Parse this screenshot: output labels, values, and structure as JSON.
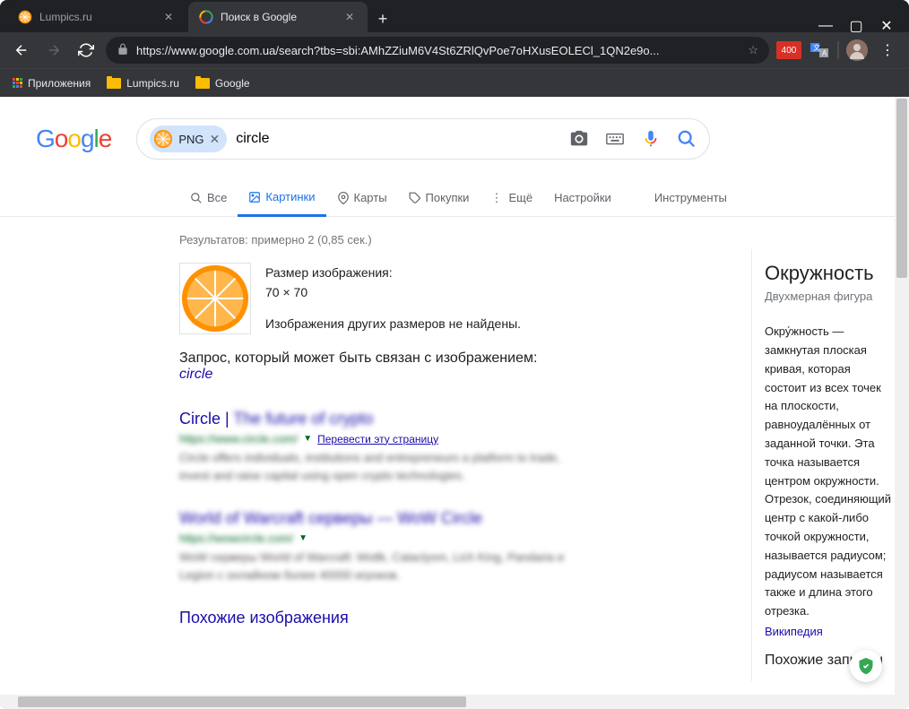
{
  "window": {
    "tabs": [
      {
        "title": "Lumpics.ru",
        "active": false
      },
      {
        "title": "Поиск в Google",
        "active": true
      }
    ]
  },
  "toolbar": {
    "url": "https://www.google.com.ua/search?tbs=sbi:AMhZZiuM6V4St6ZRlQvPoe7oHXusEOLECl_1QN2e9o...",
    "ext_badge": "400"
  },
  "bookmarks": {
    "apps": "Приложения",
    "lumpics": "Lumpics.ru",
    "google": "Google"
  },
  "search": {
    "chip_label": "PNG",
    "query": "circle"
  },
  "tabs": {
    "all": "Все",
    "images": "Картинки",
    "maps": "Карты",
    "shopping": "Покупки",
    "more": "Ещё",
    "settings": "Настройки",
    "tools": "Инструменты"
  },
  "results": {
    "stats": "Результатов: примерно 2 (0,85 сек.)",
    "img_size_label": "Размер изображения:",
    "img_size": "70 × 70",
    "no_other_sizes": "Изображения других размеров не найдены.",
    "related_prefix": "Запрос, который может быть связан с изображением: ",
    "related_term": "circle",
    "r1_title_clear": "Circle | ",
    "r1_title_blur": "The future of crypto",
    "r1_url_blur": "https://www.circle.com/",
    "r1_translate": "Перевести эту страницу",
    "r1_snippet": "Circle offers individuals, institutions and entrepreneurs a platform to trade, invest and raise capital using open crypto technologies.",
    "r2_title": "World of Warcraft серверы — WoW Circle",
    "r2_url": "https://wowcircle.com/",
    "r2_snippet": "WoW серверы World of Warcraft: Wotlk, Cataclysm, Lich King, Pandaria и Legion с онлайном более 40000 игроков.",
    "similar_heading": "Похожие изображения"
  },
  "kp": {
    "title": "Окружность",
    "subtitle": "Двухмерная фигура",
    "desc": "Окру́жность — замкнутая плоская кривая, которая состоит из всех точек на плоскости, равноудалённых от заданной точки. Эта точка называется центром окружности. Отрезок, соединяющий центр с какой-либо точкой окружности, называется радиусом; радиусом называется также и длина этого отрезка.",
    "source": "Википедия",
    "more": "Похожие запросы"
  }
}
